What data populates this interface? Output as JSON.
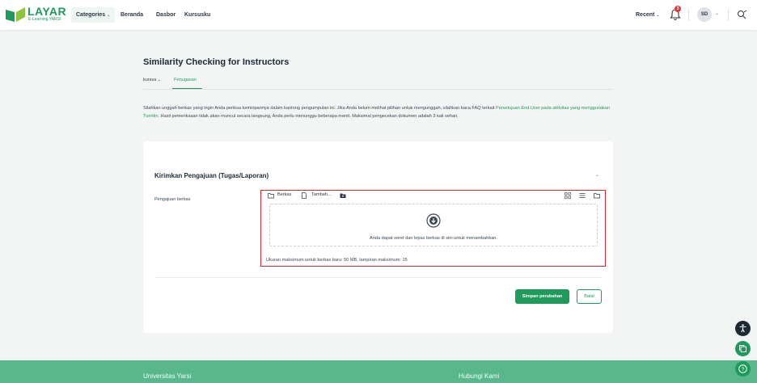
{
  "brand": {
    "name": "LAYAR",
    "tagline": "E-Learning YARSI",
    "color": "#1e9a5a"
  },
  "nav": {
    "categories": "Categories",
    "links": [
      "Beranda",
      "Dasbor",
      "Kursusku"
    ],
    "recent": "Recent",
    "notification_count": "3",
    "user_initials": "SD"
  },
  "page": {
    "title": "Similarity Checking for Instructors",
    "tabs": {
      "kursus": "kursus",
      "penugasan": "Penugasan"
    },
    "intro_part1": "Silahkan unggah berkas yang ingin Anda periksa kemiripannya dalam kantong pengumpulan ini. Jika Anda belum melihat pilihan untuk mengunggah, silahkan baca FAQ terkait ",
    "intro_link": "Persetujuan End User pada aktivitas yang menggunakan Turnitin",
    "intro_part2": ". Hasil pemeriksaan tidak akan muncul secara langsung, Anda perlu menunggu beberapa menit. Maksimal pengecekan dokumen adalah 3 kali sehari."
  },
  "form": {
    "section_title": "Kirimkan Pengajuan (Tugas/Laporan)",
    "field_label": "Pengajuan berkas",
    "toolbar": {
      "files": "Berkas",
      "add": "Tambah..."
    },
    "dropzone_text": "Anda dapat seret dan lepas berkas di sini untuk menambahkan.",
    "max_info": "Ukuran maksimum untuk berkas baru: 50 MB, lampiran maksimum: 15",
    "save": "Simpan perubahan",
    "cancel": "Batal"
  },
  "footer": {
    "left": "Universitas Yarsi",
    "right": "Hubungi Kami"
  },
  "colors": {
    "accent": "#1e9a5a",
    "footer": "#58b78d",
    "highlight": "#d62828",
    "badge": "#e5383b"
  }
}
